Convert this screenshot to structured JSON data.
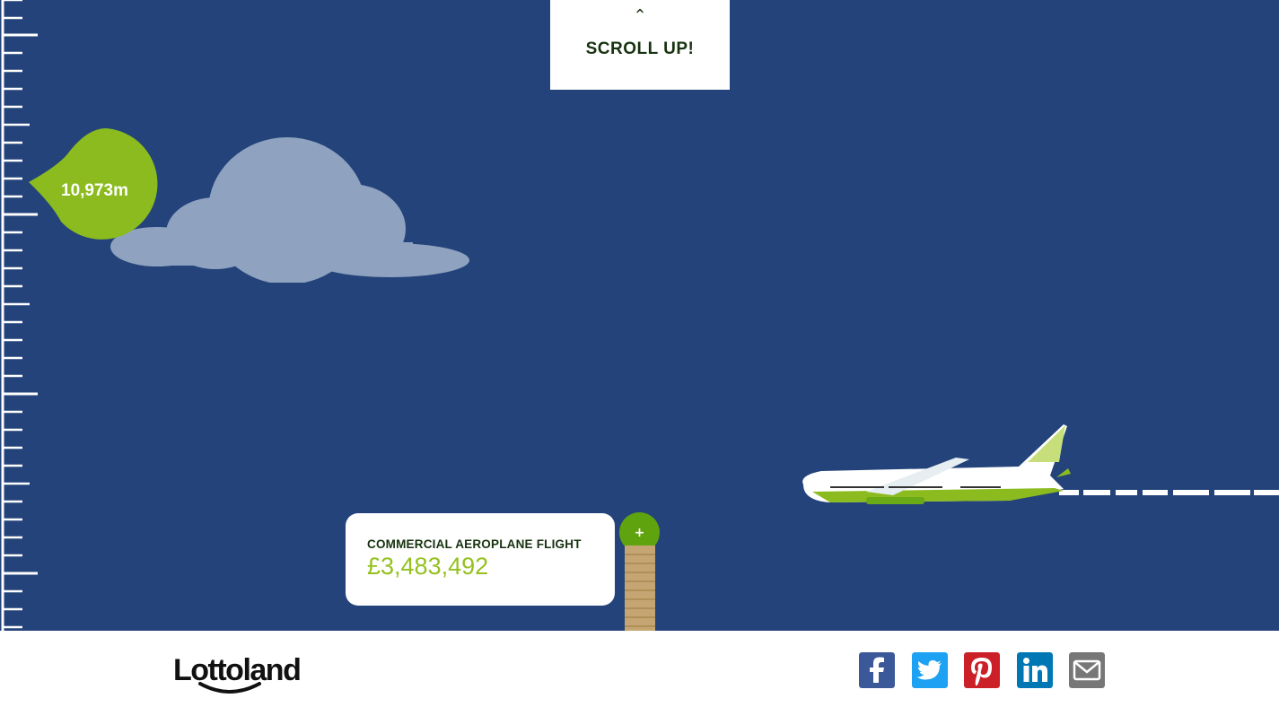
{
  "scroll": {
    "label": "SCROLL UP!",
    "icon": "chevron-up-icon"
  },
  "altitude": {
    "value": "10,973m"
  },
  "card": {
    "title": "COMMERCIAL AEROPLANE FLIGHT",
    "value": "£3,483,492",
    "expand_label": "+"
  },
  "footer": {
    "logo": "Lottoland",
    "share": [
      "facebook-icon",
      "twitter-icon",
      "pinterest-icon",
      "linkedin-icon",
      "email-icon"
    ]
  },
  "colors": {
    "sky": "#23437a",
    "accent_green": "#95c11f",
    "dark_green": "#17320f",
    "button_green": "#5fa30f",
    "facebook": "#3b5998",
    "twitter": "#1da1f2",
    "pinterest": "#cb2027",
    "linkedin": "#0077b5",
    "email": "#777777"
  }
}
